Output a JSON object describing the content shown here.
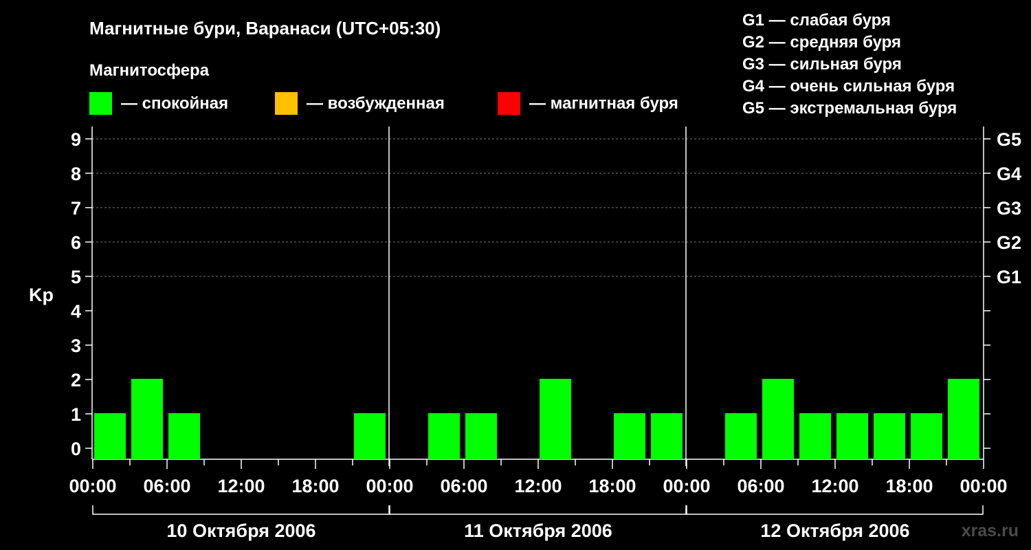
{
  "header": {
    "title": "Магнитные бури, Варанаси (UTC+05:30)",
    "subtitle": "Магнитосфера",
    "site": "xras.ru"
  },
  "legend_states": [
    {
      "label": "— спокойная",
      "color": "#00ff00"
    },
    {
      "label": "— возбужденная",
      "color": "#ffc000"
    },
    {
      "label": "— магнитная буря",
      "color": "#ff0000"
    }
  ],
  "legend_storms": [
    "G1 — слабая буря",
    "G2 — средняя буря",
    "G3 — сильная буря",
    "G4 — очень сильная буря",
    "G5 — экстремальная буря"
  ],
  "chart_data": {
    "type": "bar",
    "ylabel": "Kp",
    "ylim": [
      0,
      9
    ],
    "y_ticks": [
      "0",
      "1",
      "2",
      "3",
      "4",
      "5",
      "6",
      "7",
      "8",
      "9"
    ],
    "g_levels": [
      {
        "label": "G1",
        "kp": 5
      },
      {
        "label": "G2",
        "kp": 6
      },
      {
        "label": "G3",
        "kp": 7
      },
      {
        "label": "G4",
        "kp": 8
      },
      {
        "label": "G5",
        "kp": 9
      }
    ],
    "x_tick_labels": [
      "00:00",
      "06:00",
      "12:00",
      "18:00",
      "00:00",
      "06:00",
      "12:00",
      "18:00",
      "00:00",
      "06:00",
      "12:00",
      "18:00",
      "00:00"
    ],
    "days": [
      "10 Октября 2006",
      "11 Октября 2006",
      "12 Октября 2006"
    ],
    "interval_hours": 3,
    "grid": "dashed at Kp 5–9",
    "series": [
      {
        "values": [
          1,
          2,
          1,
          null,
          null,
          null,
          null,
          1,
          null,
          1,
          1,
          null,
          2,
          null,
          1,
          1,
          null,
          1,
          2,
          1,
          1,
          1,
          1,
          2
        ],
        "color": "#00ff00"
      }
    ]
  }
}
